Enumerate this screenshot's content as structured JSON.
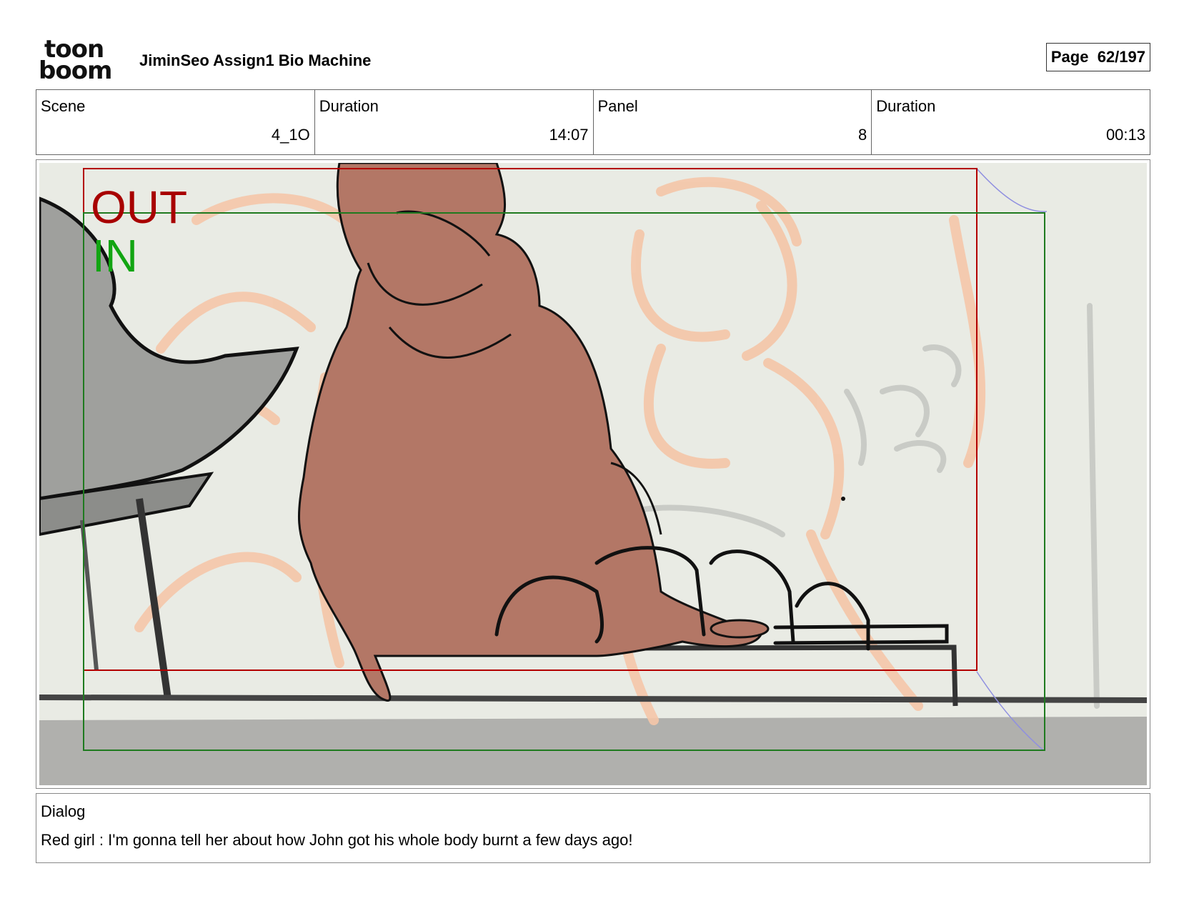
{
  "header": {
    "logo_top": "toon",
    "logo_bottom": "boom",
    "project_title": "JiminSeo Assign1 Bio Machine",
    "page_label": "Page",
    "page_number": "62/197"
  },
  "info": {
    "scene_label": "Scene",
    "scene_value": "4_1O",
    "scene_duration_label": "Duration",
    "scene_duration_value": "14:07",
    "panel_label": "Panel",
    "panel_value": "8",
    "panel_duration_label": "Duration",
    "panel_duration_value": "00:13"
  },
  "panel": {
    "out_label": "OUT",
    "in_label": "IN",
    "colors": {
      "out_frame": "#b30000",
      "in_frame": "#1f7a1f",
      "in_text": "#12a512",
      "out_text": "#a80000",
      "figure_fill": "#b37766",
      "background": "#e9ebe4",
      "floor": "#b0b0ad",
      "rough_sketch": "#f5c6a8"
    }
  },
  "dialog": {
    "label": "Dialog",
    "text": "Red girl : I'm gonna tell her about how John got his whole body burnt a few days ago!"
  }
}
